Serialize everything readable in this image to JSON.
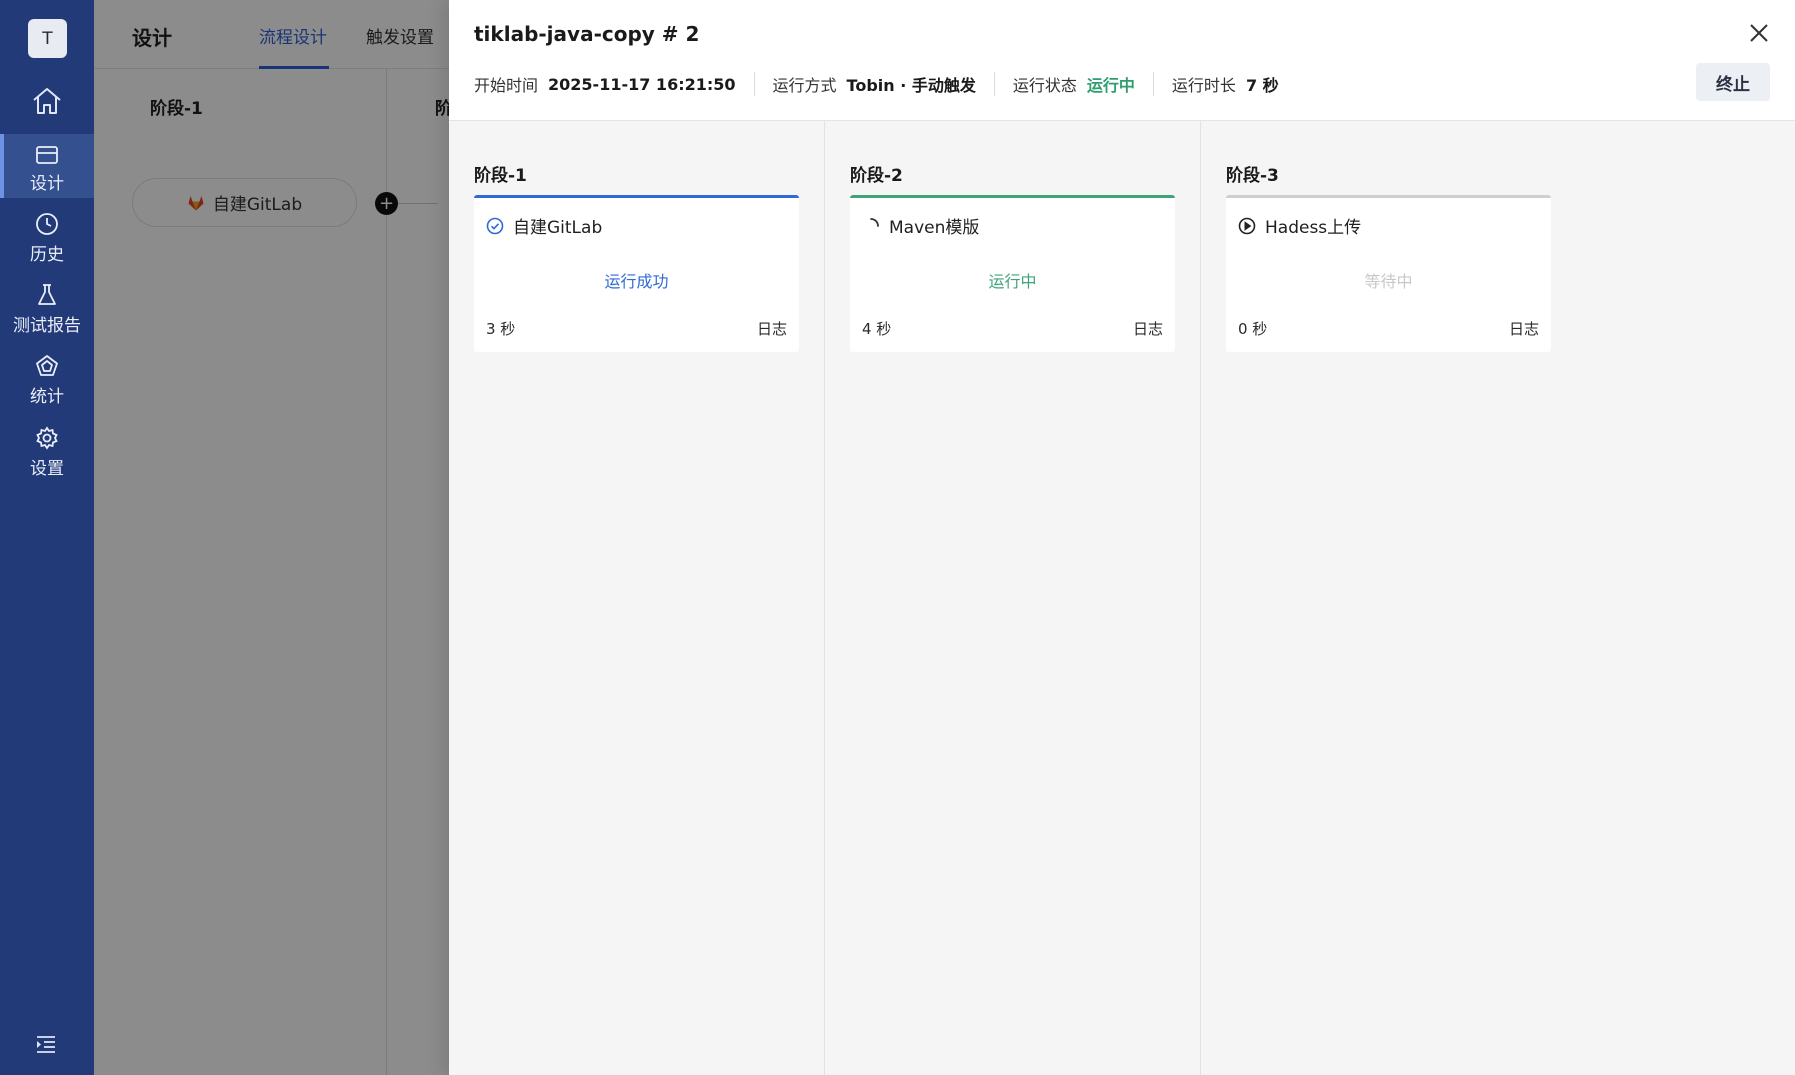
{
  "sidebar": {
    "avatar_letter": "T",
    "items": [
      {
        "label": "设计",
        "icon": "card-icon",
        "active": true
      },
      {
        "label": "历史",
        "icon": "clock-icon",
        "active": false
      },
      {
        "label": "测试报告",
        "icon": "flask-icon",
        "active": false
      },
      {
        "label": "统计",
        "icon": "pentagon-chart-icon",
        "active": false
      },
      {
        "label": "设置",
        "icon": "gear-icon",
        "active": false
      }
    ]
  },
  "design": {
    "title": "设计",
    "tabs": [
      {
        "label": "流程设计",
        "active": true
      },
      {
        "label": "触发设置",
        "active": false
      }
    ],
    "stage1_label": "阶段-1",
    "stage2_label": "阶",
    "node_label": "自建GitLab"
  },
  "run": {
    "title": "tiklab-java-copy # 2",
    "start_time_label": "开始时间",
    "start_time": "2025-11-17 16:21:50",
    "mode_label": "运行方式",
    "mode": "Tobin · 手动触发",
    "status_label": "运行状态",
    "status": "运行中",
    "duration_label": "运行时长",
    "duration": "7 秒",
    "stop_label": "终止",
    "stages": [
      {
        "label": "阶段-1",
        "task": "自建GitLab",
        "status": "运行成功",
        "time": "3 秒",
        "log": "日志",
        "state": "success"
      },
      {
        "label": "阶段-2",
        "task": "Maven模版",
        "status": "运行中",
        "time": "4 秒",
        "log": "日志",
        "state": "running"
      },
      {
        "label": "阶段-3",
        "task": "Hadess上传",
        "status": "等待中",
        "time": "0 秒",
        "log": "日志",
        "state": "waiting"
      }
    ]
  },
  "colors": {
    "sidebar": "#233a78",
    "accent": "#2f6ad6",
    "success_green": "#3fa37a",
    "waiting_gray": "#c8c8c8"
  }
}
